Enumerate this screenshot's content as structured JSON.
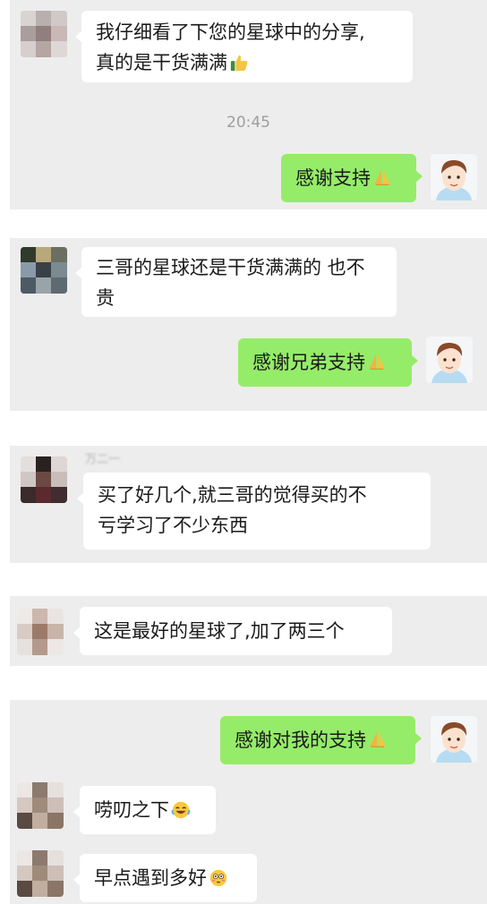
{
  "panels": [
    {
      "messages": [
        {
          "lines": [
            "我仔细看了下您的星球中的分享,",
            "真的是干货满满"
          ],
          "emoji": "thumbs-up"
        }
      ],
      "timestamp": "20:45",
      "reply": {
        "text": "感谢支持",
        "emoji": "folded-hands"
      }
    },
    {
      "messages": [
        {
          "lines": [
            "三哥的星球还是干货满满的 也不",
            "贵"
          ]
        }
      ],
      "reply": {
        "text": "感谢兄弟支持",
        "emoji": "folded-hands"
      }
    },
    {
      "sender_name": "万二一",
      "messages": [
        {
          "lines": [
            "买了好几个,就三哥的觉得买的不",
            "亏学习了不少东西"
          ]
        }
      ]
    },
    {
      "messages": [
        {
          "lines": [
            "这是最好的星球了,加了两三个"
          ]
        }
      ]
    },
    {
      "reply": {
        "text": "感谢对我的支持",
        "emoji": "folded-hands"
      },
      "messages": [
        {
          "lines": [
            "唠叨之下"
          ],
          "emoji": "tears-of-joy"
        },
        {
          "lines": [
            "早点遇到多好"
          ],
          "emoji": "flushed-face"
        }
      ]
    }
  ],
  "colors": {
    "background": "#ededed",
    "incoming_bubble": "#ffffff",
    "outgoing_bubble": "#95ec69",
    "timestamp": "#9e9e9e"
  },
  "icons": [
    "blurred-avatar",
    "cartoon-avatar",
    "thumbs-up-icon",
    "folded-hands-icon",
    "tears-of-joy-icon",
    "flushed-face-icon"
  ]
}
